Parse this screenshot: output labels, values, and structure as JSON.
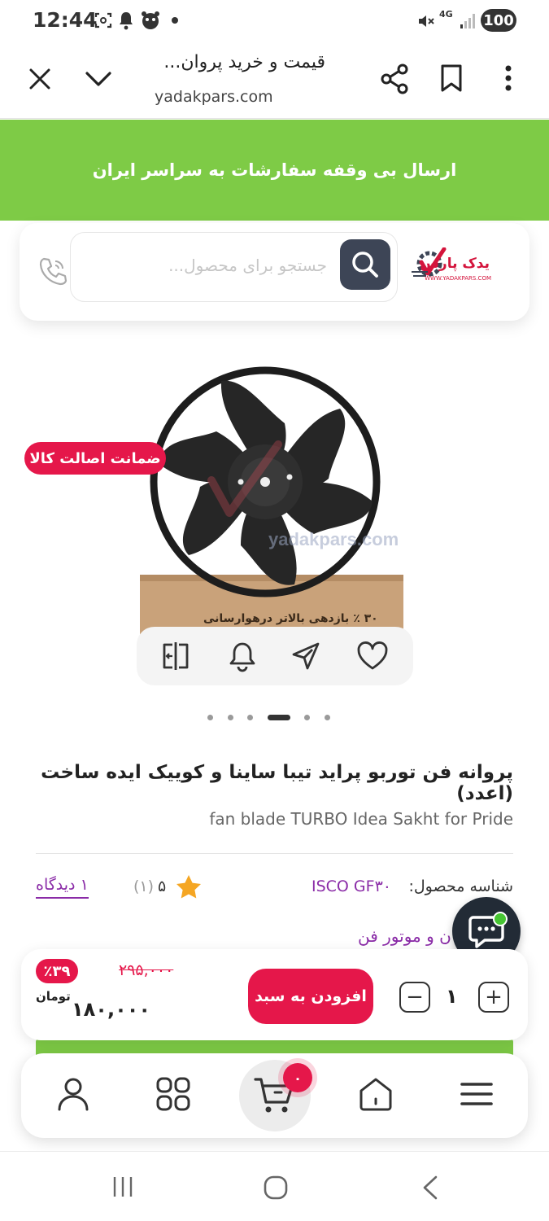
{
  "status_bar": {
    "time": "12:44",
    "network": "4G",
    "battery": "100"
  },
  "browser": {
    "page_title": "قیمت و خرید پروان...",
    "url": "yadakpars.com"
  },
  "banner": {
    "text": "ارسال بی وقفه سفارشات به سراسر ایران"
  },
  "header": {
    "search_placeholder": "جستجو برای محصول...",
    "brand_name": "یدک پارس",
    "brand_url": "WWW.YADAKPARS.COM"
  },
  "product": {
    "authenticity_badge": "ضمانت اصالت کالا",
    "box_text": "۳۰ ٪ بازدهی بالاتر درهوارسانی",
    "title": "پروانه فن توربو پراید تیبا ساینا و کوییک ایده ساخت (اعدد)",
    "english_name": "fan blade TURBO Idea Sakht for Pride",
    "sku_label": "شناسه محصول:",
    "sku_value": "ISCO GF۳۰",
    "rating_value": "۵",
    "rating_count": "(۱)",
    "reviews_link": "۱ دیدگاه",
    "category_link": "ن و موتور فن",
    "image_count": 6,
    "active_image_index": 3
  },
  "purchase": {
    "discount": "٪۳۹",
    "old_price": "۲۹۵,۰۰۰",
    "price": "۱۸۰,۰۰۰",
    "currency": "تومان",
    "add_to_cart": "افزودن به سبد",
    "quantity": "۱",
    "plus": "+",
    "minus": "−"
  },
  "bottom_nav": {
    "cart_count": "۰"
  },
  "colors": {
    "brand_green": "#7ecb46",
    "accent_red": "#e5174a",
    "link_purple": "#8a2ba7",
    "search_button": "#3d4556"
  }
}
